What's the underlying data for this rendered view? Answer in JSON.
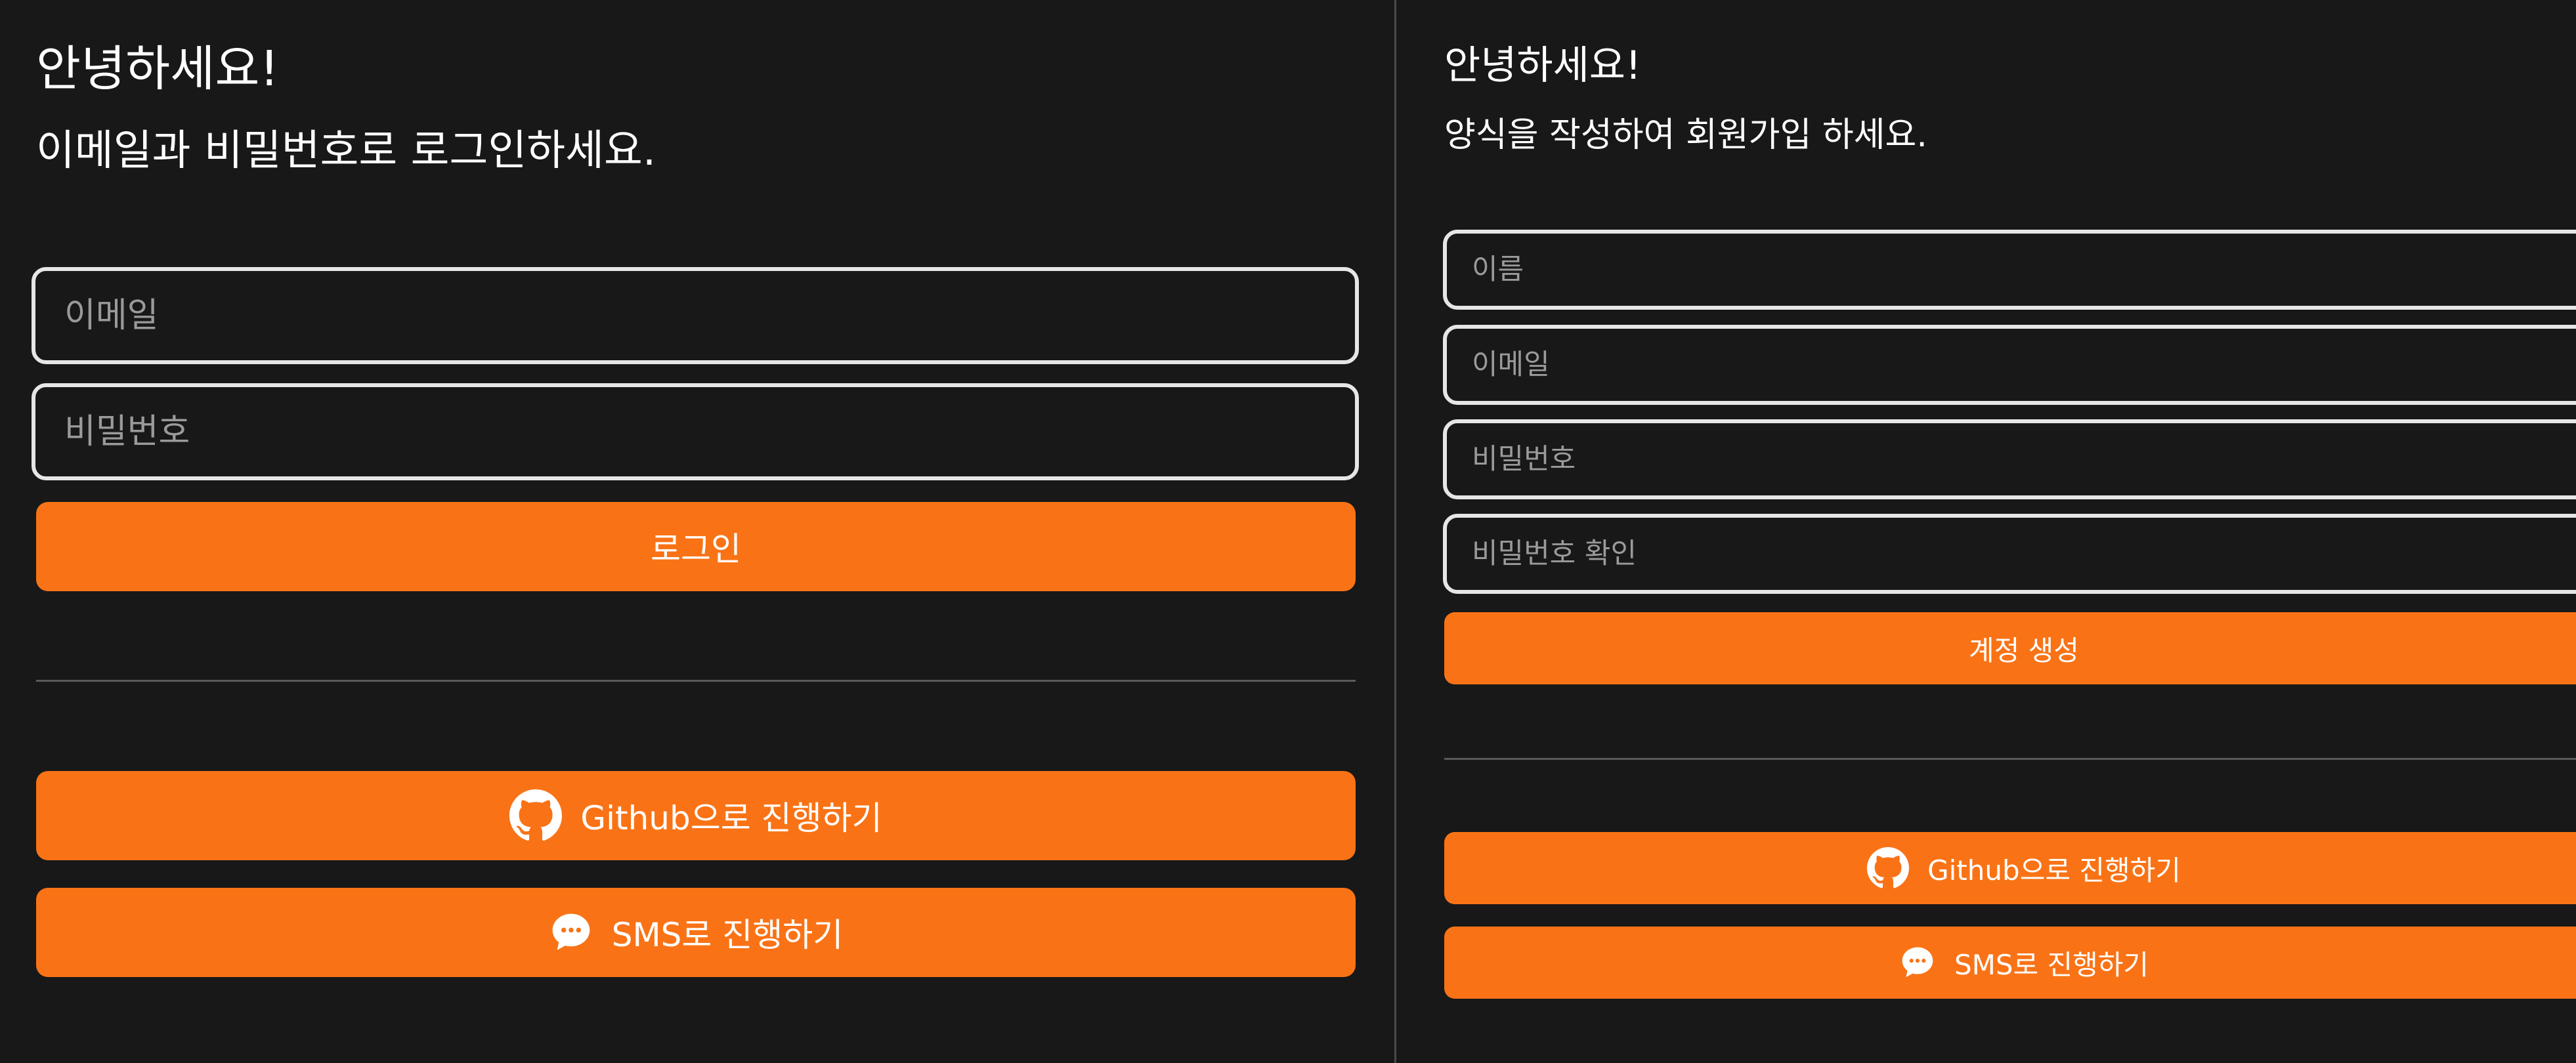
{
  "login": {
    "title": "안녕하세요!",
    "subtitle": "이메일과 비밀번호로 로그인하세요.",
    "email_placeholder": "이메일",
    "password_placeholder": "비밀번호",
    "submit_label": "로그인",
    "github_label": "Github으로 진행하기",
    "sms_label": "SMS로 진행하기"
  },
  "signup": {
    "title": "안녕하세요!",
    "subtitle": "양식을 작성하여 회원가입 하세요.",
    "name_placeholder": "이름",
    "email_placeholder": "이메일",
    "password_placeholder": "비밀번호",
    "confirm_placeholder": "비밀번호 확인",
    "submit_label": "계정 생성",
    "github_label": "Github으로 진행하기",
    "sms_label": "SMS로 진행하기"
  },
  "icons": {
    "github": "github-icon",
    "sms": "chat-bubble-icon"
  },
  "colors": {
    "background": "#181818",
    "accent": "#f97316",
    "field_border": "#e6e6e6",
    "placeholder": "#9a9a9a",
    "divider": "#5a5a5a"
  }
}
